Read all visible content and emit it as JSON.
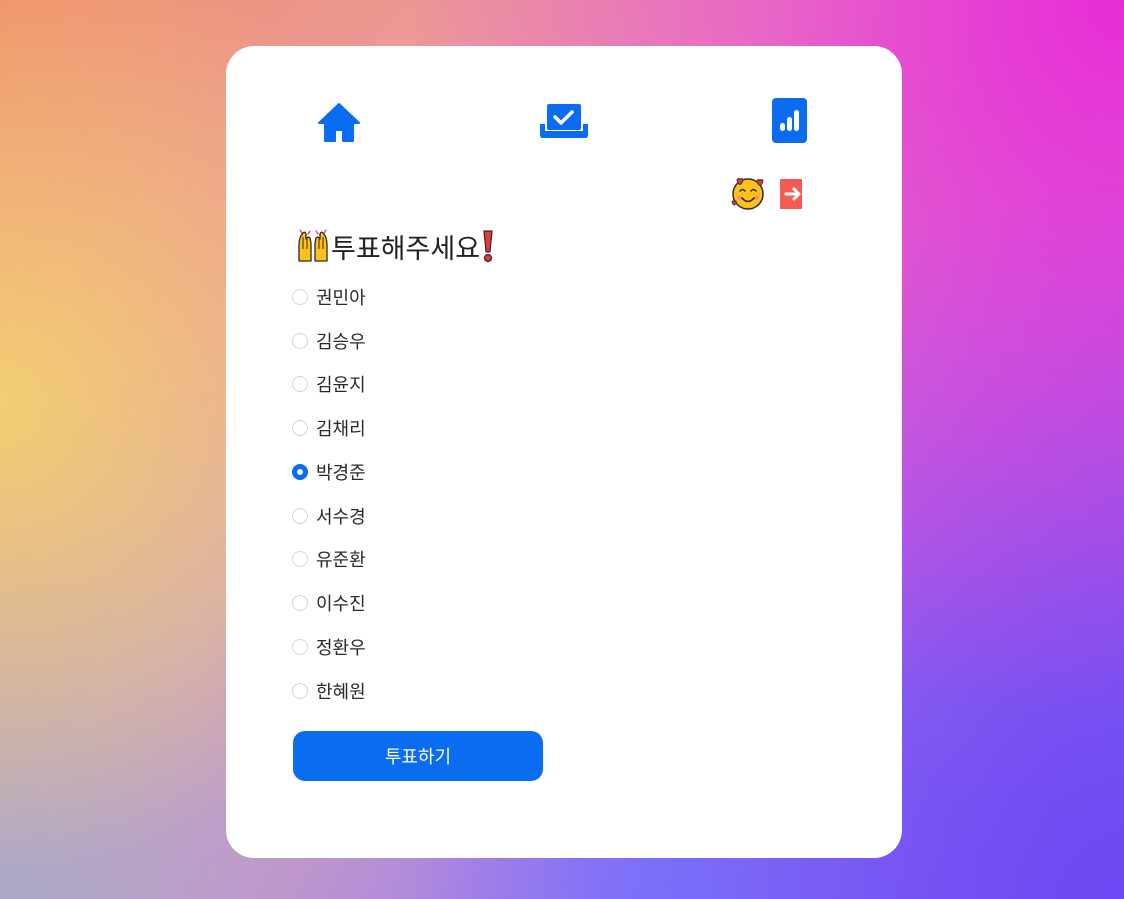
{
  "nav": {
    "items": [
      {
        "name": "home",
        "icon": "home-icon"
      },
      {
        "name": "vote",
        "icon": "ballot-box-check-icon"
      },
      {
        "name": "results",
        "icon": "bar-chart-icon"
      }
    ],
    "accent": "#0a6cf0"
  },
  "user": {
    "avatar_icon": "smiling-face-with-hearts-emoji",
    "logout_icon": "logout-arrow-icon",
    "logout_color": "#f25c54"
  },
  "vote": {
    "title_prefix_icon": "raising-hands-emoji",
    "title": "투표해주세요",
    "title_suffix_icon": "exclamation-mark-emoji",
    "selected": "박경준",
    "options": [
      {
        "label": "권민아",
        "checked": false
      },
      {
        "label": "김승우",
        "checked": false
      },
      {
        "label": "김윤지",
        "checked": false
      },
      {
        "label": "김채리",
        "checked": false
      },
      {
        "label": "박경준",
        "checked": true
      },
      {
        "label": "서수경",
        "checked": false
      },
      {
        "label": "유준환",
        "checked": false
      },
      {
        "label": "이수진",
        "checked": false
      },
      {
        "label": "정환우",
        "checked": false
      },
      {
        "label": "한혜원",
        "checked": false
      }
    ],
    "submit_label": "투표하기"
  }
}
